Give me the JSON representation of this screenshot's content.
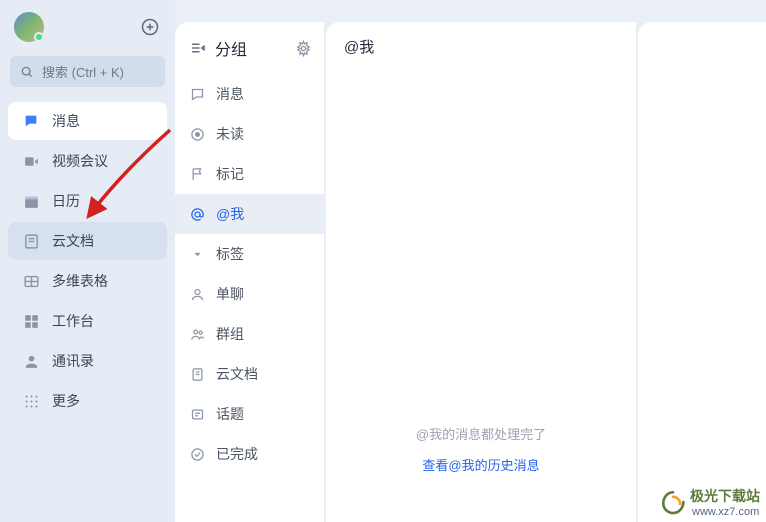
{
  "sidebar": {
    "search_placeholder": "搜索 (Ctrl + K)",
    "items": [
      {
        "label": "消息"
      },
      {
        "label": "视频会议"
      },
      {
        "label": "日历"
      },
      {
        "label": "云文档"
      },
      {
        "label": "多维表格"
      },
      {
        "label": "工作台"
      },
      {
        "label": "通讯录"
      },
      {
        "label": "更多"
      }
    ]
  },
  "groups": {
    "title": "分组",
    "items": [
      {
        "label": "消息"
      },
      {
        "label": "未读"
      },
      {
        "label": "标记"
      },
      {
        "label": "@我"
      },
      {
        "label": "标签"
      },
      {
        "label": "单聊"
      },
      {
        "label": "群组"
      },
      {
        "label": "云文档"
      },
      {
        "label": "话题"
      },
      {
        "label": "已完成"
      }
    ]
  },
  "content": {
    "title": "@我",
    "empty_text": "@我的消息都处理完了",
    "history_link": "查看@我的历史消息"
  },
  "watermark": {
    "text1": "极光下载站",
    "text2": "www.xz7.com"
  }
}
